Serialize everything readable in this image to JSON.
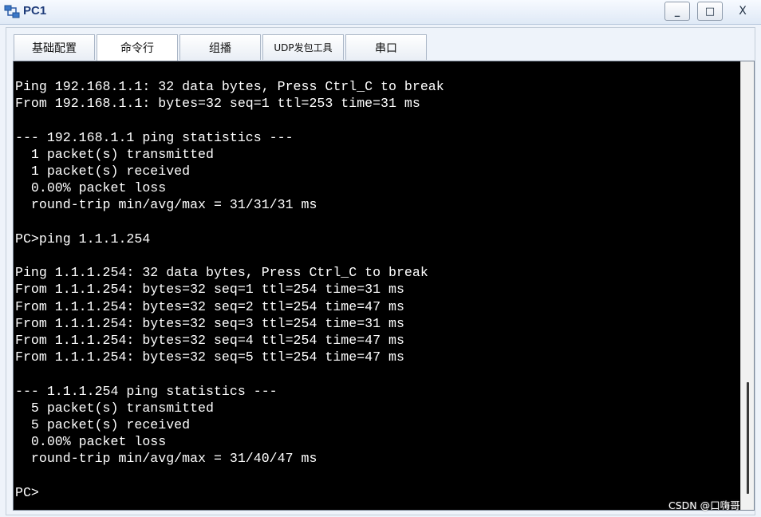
{
  "window": {
    "title": "PC1",
    "icon": "network-pc-icon",
    "controls": {
      "minimize": "_",
      "maximize": "□",
      "close": "X"
    }
  },
  "tabs": [
    {
      "label": "基础配置",
      "active": false
    },
    {
      "label": "命令行",
      "active": true
    },
    {
      "label": "组播",
      "active": false
    },
    {
      "label": "UDP发包工具",
      "active": false
    },
    {
      "label": "串口",
      "active": false
    }
  ],
  "terminal": {
    "lines": [
      "Ping 192.168.1.1: 32 data bytes, Press Ctrl_C to break",
      "From 192.168.1.1: bytes=32 seq=1 ttl=253 time=31 ms",
      "",
      "--- 192.168.1.1 ping statistics ---",
      "  1 packet(s) transmitted",
      "  1 packet(s) received",
      "  0.00% packet loss",
      "  round-trip min/avg/max = 31/31/31 ms",
      "",
      "PC>ping 1.1.1.254",
      "",
      "Ping 1.1.1.254: 32 data bytes, Press Ctrl_C to break",
      "From 1.1.1.254: bytes=32 seq=1 ttl=254 time=31 ms",
      "From 1.1.1.254: bytes=32 seq=2 ttl=254 time=47 ms",
      "From 1.1.1.254: bytes=32 seq=3 ttl=254 time=31 ms",
      "From 1.1.1.254: bytes=32 seq=4 ttl=254 time=47 ms",
      "From 1.1.1.254: bytes=32 seq=5 ttl=254 time=47 ms",
      "",
      "--- 1.1.1.254 ping statistics ---",
      "  5 packet(s) transmitted",
      "  5 packet(s) received",
      "  0.00% packet loss",
      "  round-trip min/avg/max = 31/40/47 ms",
      "",
      "PC>"
    ]
  },
  "watermark": "CSDN @口嗨哥",
  "colors": {
    "terminal_bg": "#000000",
    "terminal_fg": "#ffffff",
    "title": "#1f3c7a",
    "window_bg": "#eef3fa"
  }
}
